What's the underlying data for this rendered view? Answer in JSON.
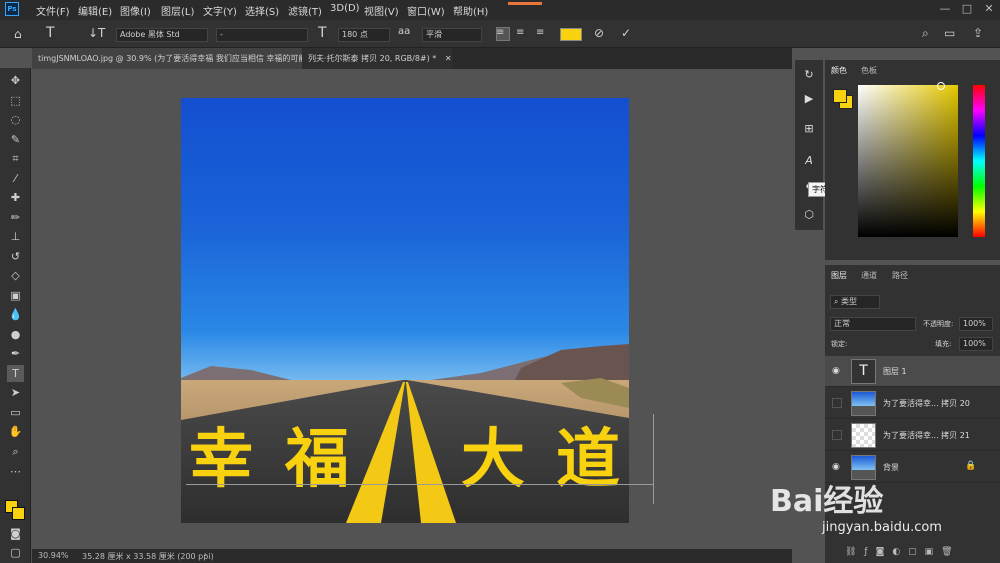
{
  "menubar": {
    "logo": "Ps",
    "items": [
      "文件(F)",
      "编辑(E)",
      "图像(I)",
      "图层(L)",
      "文字(Y)",
      "选择(S)",
      "滤镜(T)",
      "3D(D)",
      "视图(V)",
      "窗口(W)",
      "帮助(H)"
    ],
    "window_controls": [
      "—",
      "□",
      "✕"
    ]
  },
  "options": {
    "font_family": "Adobe 黑体 Std",
    "font_style": "-",
    "font_size": "180 点",
    "antialias": "平滑",
    "text_color": "#f8d10f"
  },
  "tabs": [
    {
      "label": "timgJSNMLOAO.jpg @ 30.9% (为了要活得幸福 我们应当相信 幸福的可能",
      "close": "✕"
    },
    {
      "label": "列夫·托尔斯泰 拷贝 20, RGB/8#) *",
      "close": "✕"
    }
  ],
  "canvas": {
    "text": [
      "幸",
      "福",
      "大",
      "道"
    ]
  },
  "status": {
    "zoom": "30.94%",
    "doc_size": "35.28 厘米 x 33.58 厘米 (200 ppi)",
    "arrow": "›"
  },
  "dock": {
    "tooltip": "字符"
  },
  "color_panel": {
    "tabs": [
      "颜色",
      "色板"
    ],
    "foreground": "#f8d10f",
    "background": "#f8d10f"
  },
  "layers_panel": {
    "tabs": [
      "图层",
      "通道",
      "路径"
    ],
    "filter_kind": "类型",
    "blend_mode": "正常",
    "opacity_label": "不透明度:",
    "opacity": "100%",
    "lock_label": "锁定:",
    "fill_label": "填充:",
    "fill": "100%",
    "layers": [
      {
        "name": "图层 1",
        "type": "text",
        "selected": true,
        "visible": true
      },
      {
        "name": "为了要活得幸... 拷贝 20",
        "type": "image",
        "selected": false,
        "visible": false
      },
      {
        "name": "为了要活得幸... 拷贝 21",
        "type": "smart",
        "selected": false,
        "visible": false
      },
      {
        "name": "背景",
        "type": "image",
        "selected": false,
        "visible": true,
        "locked": true
      }
    ]
  },
  "watermark": {
    "brand": "Bai经验",
    "url": "jingyan.baidu.com"
  }
}
